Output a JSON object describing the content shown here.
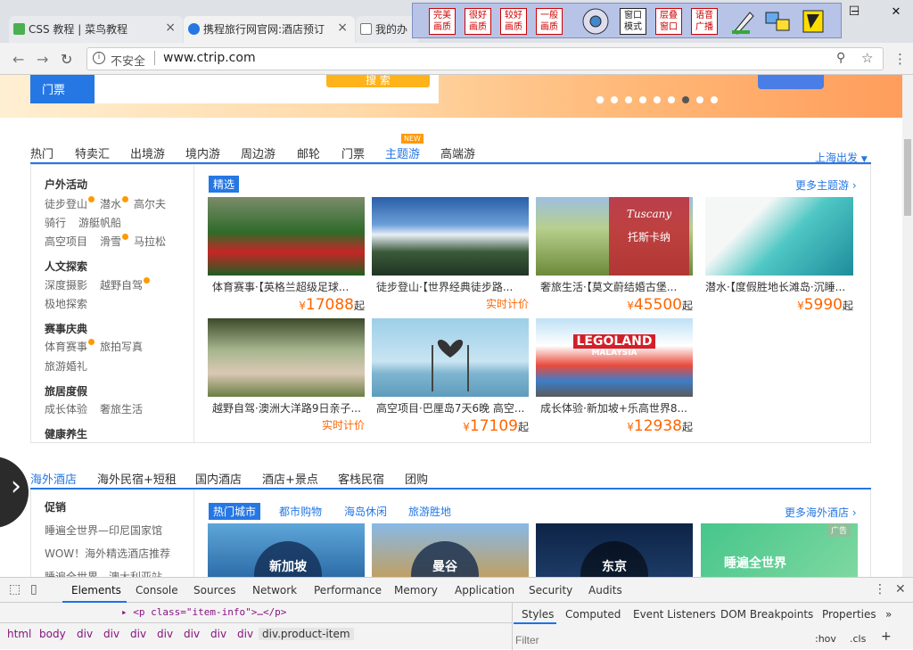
{
  "tabs": [
    {
      "label": "CSS 教程 | 菜鸟教程",
      "close": "×"
    },
    {
      "label": "携程旅行网官网:酒店预订",
      "close": "×"
    },
    {
      "label": "我的办"
    }
  ],
  "window_controls": {
    "minimize": "─",
    "maximize": "☐",
    "close": "✕"
  },
  "ext_toolbar": {
    "buttons": [
      {
        "l1": "完美",
        "l2": "画质"
      },
      {
        "l1": "很好",
        "l2": "画质"
      },
      {
        "l1": "较好",
        "l2": "画质"
      },
      {
        "l1": "一般",
        "l2": "画质"
      },
      {
        "l1": "窗口",
        "l2": "模式"
      },
      {
        "l1": "层叠",
        "l2": "窗口"
      },
      {
        "l1": "语音",
        "l2": "广播"
      }
    ]
  },
  "address": {
    "security": "不安全",
    "url": "www.ctrip.com"
  },
  "banner": {
    "ticket_label": "门票",
    "search_btn": "搜 索"
  },
  "theme_nav": {
    "tabs": [
      "热门",
      "特卖汇",
      "出境游",
      "境内游",
      "周边游",
      "邮轮",
      "门票",
      "主题游",
      "高端游"
    ],
    "badge": "NEW",
    "depart": "上海出发",
    "selected_tag": "精选",
    "more": "更多主题游"
  },
  "left_menu": [
    {
      "title": "户外活动",
      "rows": [
        [
          "徒步登山",
          "潜水",
          "高尔夫"
        ],
        [
          "骑行",
          "游艇帆船"
        ],
        [
          "高空项目",
          "滑雪",
          "马拉松"
        ]
      ]
    },
    {
      "title": "人文探索",
      "rows": [
        [
          "深度摄影",
          "越野自驾"
        ],
        [
          "极地探索"
        ]
      ]
    },
    {
      "title": "赛事庆典",
      "rows": [
        [
          "体育赛事",
          "旅拍写真"
        ],
        [
          "旅游婚礼"
        ]
      ]
    },
    {
      "title": "旅居度假",
      "rows": [
        [
          "成长体验",
          "奢旅生活"
        ]
      ]
    },
    {
      "title": "健康养生",
      "rows": []
    }
  ],
  "products": [
    {
      "name": "体育赛事·【英格兰超级足球...",
      "symbol": "¥",
      "price": "17088",
      "unit": "起"
    },
    {
      "name": "徒步登山·【世界经典徒步路...",
      "realtime": "实时计价"
    },
    {
      "name": "奢旅生活·【莫文蔚结婚古堡...",
      "symbol": "¥",
      "price": "45500",
      "unit": "起"
    },
    {
      "name": "潜水·【度假胜地长滩岛·沉睡...",
      "symbol": "¥",
      "price": "5990",
      "unit": "起"
    },
    {
      "name": "越野自驾·澳洲大洋路9日亲子...",
      "realtime": "实时计价"
    },
    {
      "name": "高空项目·巴厘岛7天6晚 高空...",
      "symbol": "¥",
      "price": "17109",
      "unit": "起"
    },
    {
      "name": "成长体验·新加坡+乐高世界8...",
      "symbol": "¥",
      "price": "12938",
      "unit": "起"
    }
  ],
  "image_text": {
    "tuscany": "Tuscany",
    "tuscany_cn": "托斯卡纳",
    "legoland": "LEGOLAND",
    "malaysia": "MALAYSIA"
  },
  "hotel_nav": {
    "tabs": [
      "海外酒店",
      "海外民宿+短租",
      "国内酒店",
      "酒店+景点",
      "客栈民宿",
      "团购"
    ],
    "promo_title": "促销",
    "promo_items": [
      "睡遍全世界—印尼国家馆",
      "WOW！海外精选酒店推荐",
      "睡遍全世界—澳大利亚站"
    ],
    "sub_tabs": [
      "热门城市",
      "都市购物",
      "海岛休闲",
      "旅游胜地"
    ],
    "more": "更多海外酒店",
    "cities": [
      "新加坡",
      "曼谷",
      "东京"
    ],
    "ad_tag": "广告",
    "ad_text": "睡遍全世界"
  },
  "devtools": {
    "tabs": [
      "Elements",
      "Console",
      "Sources",
      "Network",
      "Performance",
      "Memory",
      "Application",
      "Security",
      "Audits"
    ],
    "code_line": "▸ <p class=\"item-info\">…</p>",
    "crumbs": [
      "html",
      "body",
      "div",
      "div",
      "div",
      "div",
      "div",
      "div",
      "div",
      "div.product-item"
    ],
    "style_tabs": [
      "Styles",
      "Computed",
      "Event Listeners",
      "DOM Breakpoints",
      "Properties"
    ],
    "filter_placeholder": "Filter",
    "hov": ":hov",
    "cls": ".cls",
    "plus": "+",
    "more": "»"
  },
  "colors": {
    "accent": "#2577e3",
    "price": "#ff6600",
    "tab_bg": "#dee1e6"
  }
}
